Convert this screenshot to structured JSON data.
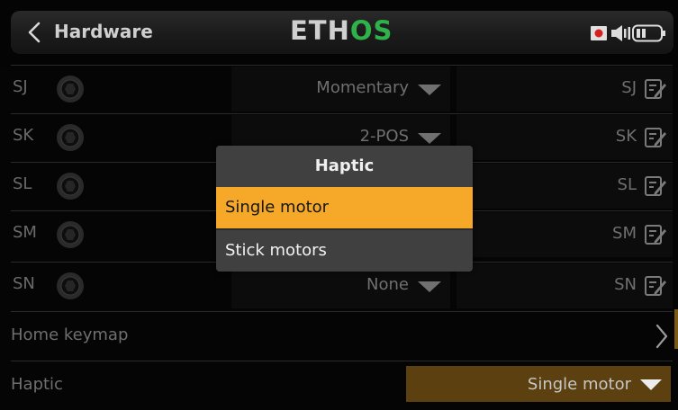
{
  "header": {
    "back_label": "Hardware",
    "brand_part1": "ETH",
    "brand_part2": "OS",
    "brand_colors": {
      "primary": "#d0d0d0",
      "accent": "#2fb24a"
    },
    "status_icons": [
      "record-icon",
      "speaker-icon",
      "battery-icon"
    ]
  },
  "switch_rows": [
    {
      "name": "SJ",
      "type": "Momentary",
      "switch_name": "SJ"
    },
    {
      "name": "SK",
      "type": "2-POS",
      "switch_name": "SK"
    },
    {
      "name": "SL",
      "type": "",
      "switch_name": "SL"
    },
    {
      "name": "SM",
      "type": "",
      "switch_name": "SM"
    },
    {
      "name": "SN",
      "type": "None",
      "switch_name": "SN"
    }
  ],
  "home_keymap": {
    "label": "Home keymap"
  },
  "haptic": {
    "label": "Haptic",
    "value": "Single motor"
  },
  "popup": {
    "title": "Haptic",
    "options": [
      "Single motor",
      "Stick motors"
    ],
    "selected_index": 0
  },
  "colors": {
    "highlight": "#f6a928",
    "selected_field": "#5c400f",
    "popup_bg": "#404040"
  }
}
